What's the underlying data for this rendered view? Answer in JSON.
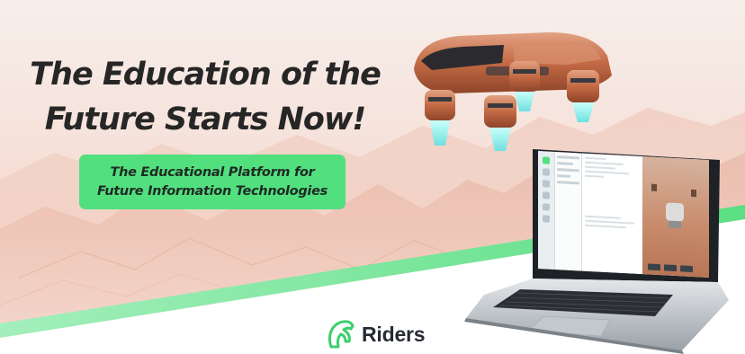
{
  "banner": {
    "headline_line1": "The Education of the",
    "headline_line2": "Future Starts Now!",
    "subtitle_line1": "The Educational Platform for",
    "subtitle_line2": "Future Information Technologies",
    "accent_color": "#52e07f",
    "text_color": "#262626"
  },
  "logo": {
    "brand_name": "Riders",
    "icon": "horse-head-icon"
  },
  "images": {
    "drone": "robot-drone-image",
    "laptop": "laptop-simulator-image",
    "background": "desert-terrain-background"
  }
}
